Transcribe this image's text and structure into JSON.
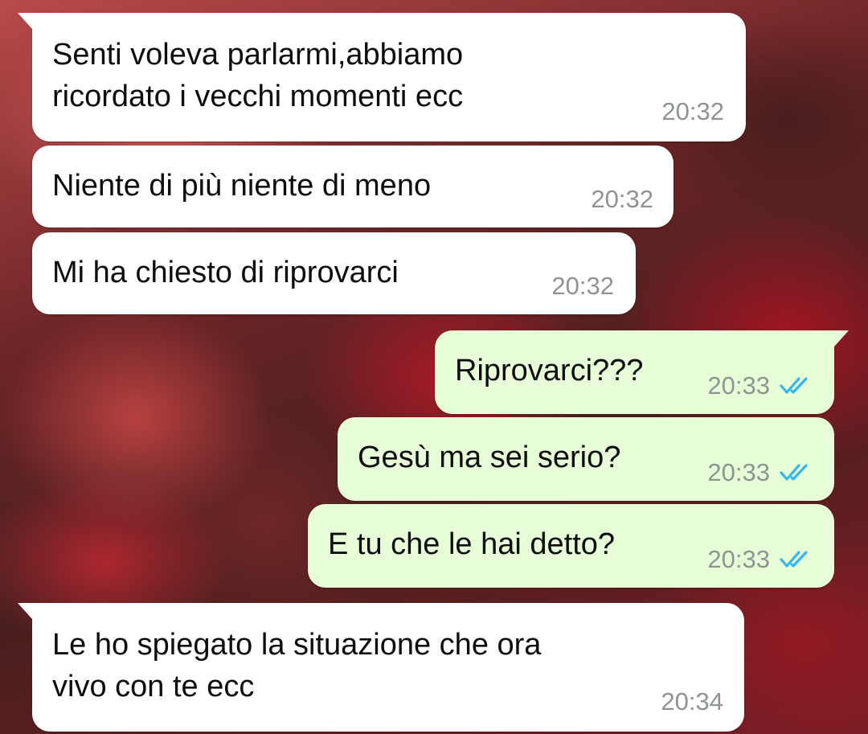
{
  "chat": {
    "messages": [
      {
        "direction": "incoming",
        "text": "Senti voleva parlarmi,abbiamo\nricordato i vecchi momenti ecc",
        "time": "20:32"
      },
      {
        "direction": "incoming",
        "text": "Niente di più niente di meno",
        "time": "20:32"
      },
      {
        "direction": "incoming",
        "text": "Mi ha chiesto di riprovarci",
        "time": "20:32"
      },
      {
        "direction": "outgoing",
        "text": "Riprovarci???",
        "time": "20:33",
        "status": "read"
      },
      {
        "direction": "outgoing",
        "text": "Gesù ma sei serio?",
        "time": "20:33",
        "status": "read"
      },
      {
        "direction": "outgoing",
        "text": "E tu che le hai detto?",
        "time": "20:33",
        "status": "read"
      },
      {
        "direction": "incoming",
        "text": "Le ho spiegato la situazione che ora\nvivo con te ecc",
        "time": "20:34"
      }
    ]
  },
  "colors": {
    "incoming_bubble": "#ffffff",
    "outgoing_bubble": "#e7fdd8",
    "read_ticks": "#34b7f1",
    "timestamp": "#8e9590"
  },
  "icons": {
    "read_status": "double-check-icon"
  }
}
